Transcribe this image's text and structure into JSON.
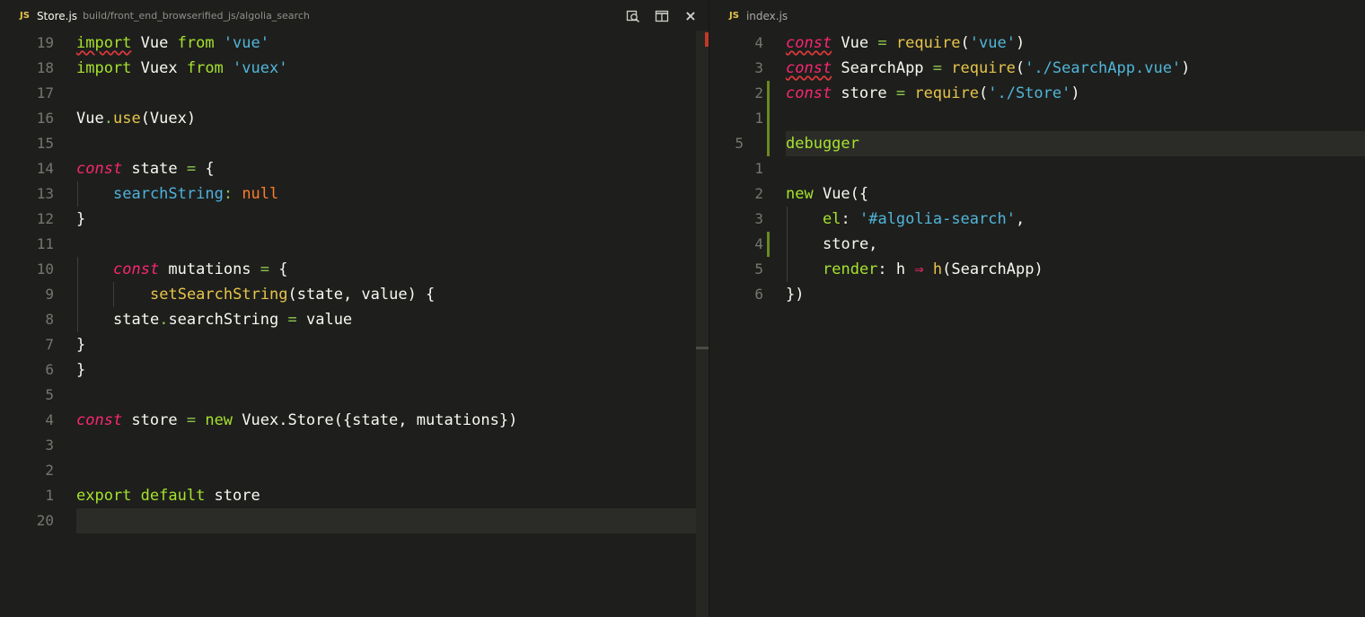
{
  "left_tab": {
    "badge": "JS",
    "title": "Store.js",
    "path": "build/front_end_browserified_js/algolia_search",
    "close_label": "×"
  },
  "right_tab": {
    "badge": "JS",
    "title": "index.js"
  },
  "left_lines": [
    {
      "n": "19",
      "k": "import",
      "a": " Vue ",
      "b": "from",
      "s": " 'vue'"
    },
    {
      "n": "18",
      "k": "import",
      "a": " Vuex ",
      "b": "from",
      "s": " 'vuex'"
    },
    {
      "n": "17"
    },
    {
      "n": "16",
      "t1": "Vue",
      "t2": ".",
      "t3": "use",
      "t4": "(Vuex)"
    },
    {
      "n": "15"
    },
    {
      "n": "14",
      "c": "const",
      "t": " state ",
      "o": "=",
      "r": " {"
    },
    {
      "n": "13",
      "p": "searchString",
      "o": ":",
      "v": " null"
    },
    {
      "n": "12",
      "t": "}"
    },
    {
      "n": "11"
    },
    {
      "n": "10",
      "c": "const",
      "t": " mutations ",
      "o": "=",
      "r": " {"
    },
    {
      "n": "9",
      "f": "setSearchString",
      "t": "(state, value) {"
    },
    {
      "n": "8",
      "a": "state",
      "b": ".",
      "c2": "searchString ",
      "o": "=",
      "r": " value"
    },
    {
      "n": "7",
      "t": "}"
    },
    {
      "n": "6",
      "t": "}"
    },
    {
      "n": "5"
    },
    {
      "n": "4",
      "c": "const",
      "t": " store ",
      "o": "=",
      "k": " new",
      "r": " Vuex.Store({state, mutations})"
    },
    {
      "n": "3"
    },
    {
      "n": "2"
    },
    {
      "n": "1",
      "k": "export",
      "k2": " default",
      "r": " store"
    },
    {
      "n": "20"
    }
  ],
  "right_lines": [
    {
      "n": "4",
      "c": "const",
      "a": " Vue ",
      "o": "=",
      "f": " require",
      "t": "(",
      "s": "'vue'",
      "r": ")"
    },
    {
      "n": "3",
      "c": "const",
      "a": " SearchApp ",
      "o": "=",
      "f": " require",
      "t": "(",
      "s": "'./SearchApp.vue'",
      "r": ")"
    },
    {
      "n": "2",
      "c": "const",
      "a": " store ",
      "o": "=",
      "f": " require",
      "t": "(",
      "s": "'./Store'",
      "r": ")"
    },
    {
      "n": "1"
    },
    {
      "n": "5",
      "k": "debugger"
    },
    {
      "n": "1"
    },
    {
      "n": "2",
      "k": "new",
      "r": " Vue({"
    },
    {
      "n": "3",
      "p": "el",
      "o": ":",
      "s": " '#algolia-search'",
      "r": ","
    },
    {
      "n": "4",
      "t": "store,"
    },
    {
      "n": "5",
      "p": "render",
      "o": ":",
      "a": " h ",
      "ar": "⇒",
      "f": " h",
      "r": "(SearchApp)"
    },
    {
      "n": "6",
      "t": "})"
    }
  ],
  "colors": {
    "background": "#1e1f1c",
    "keyword": "#a6e22e",
    "string": "#51b5da",
    "storage": "#f92672",
    "function": "#e6c44c",
    "null": "#fd7c2e"
  },
  "icons": [
    "find-in-project-icon",
    "split-pane-icon",
    "close-icon"
  ]
}
